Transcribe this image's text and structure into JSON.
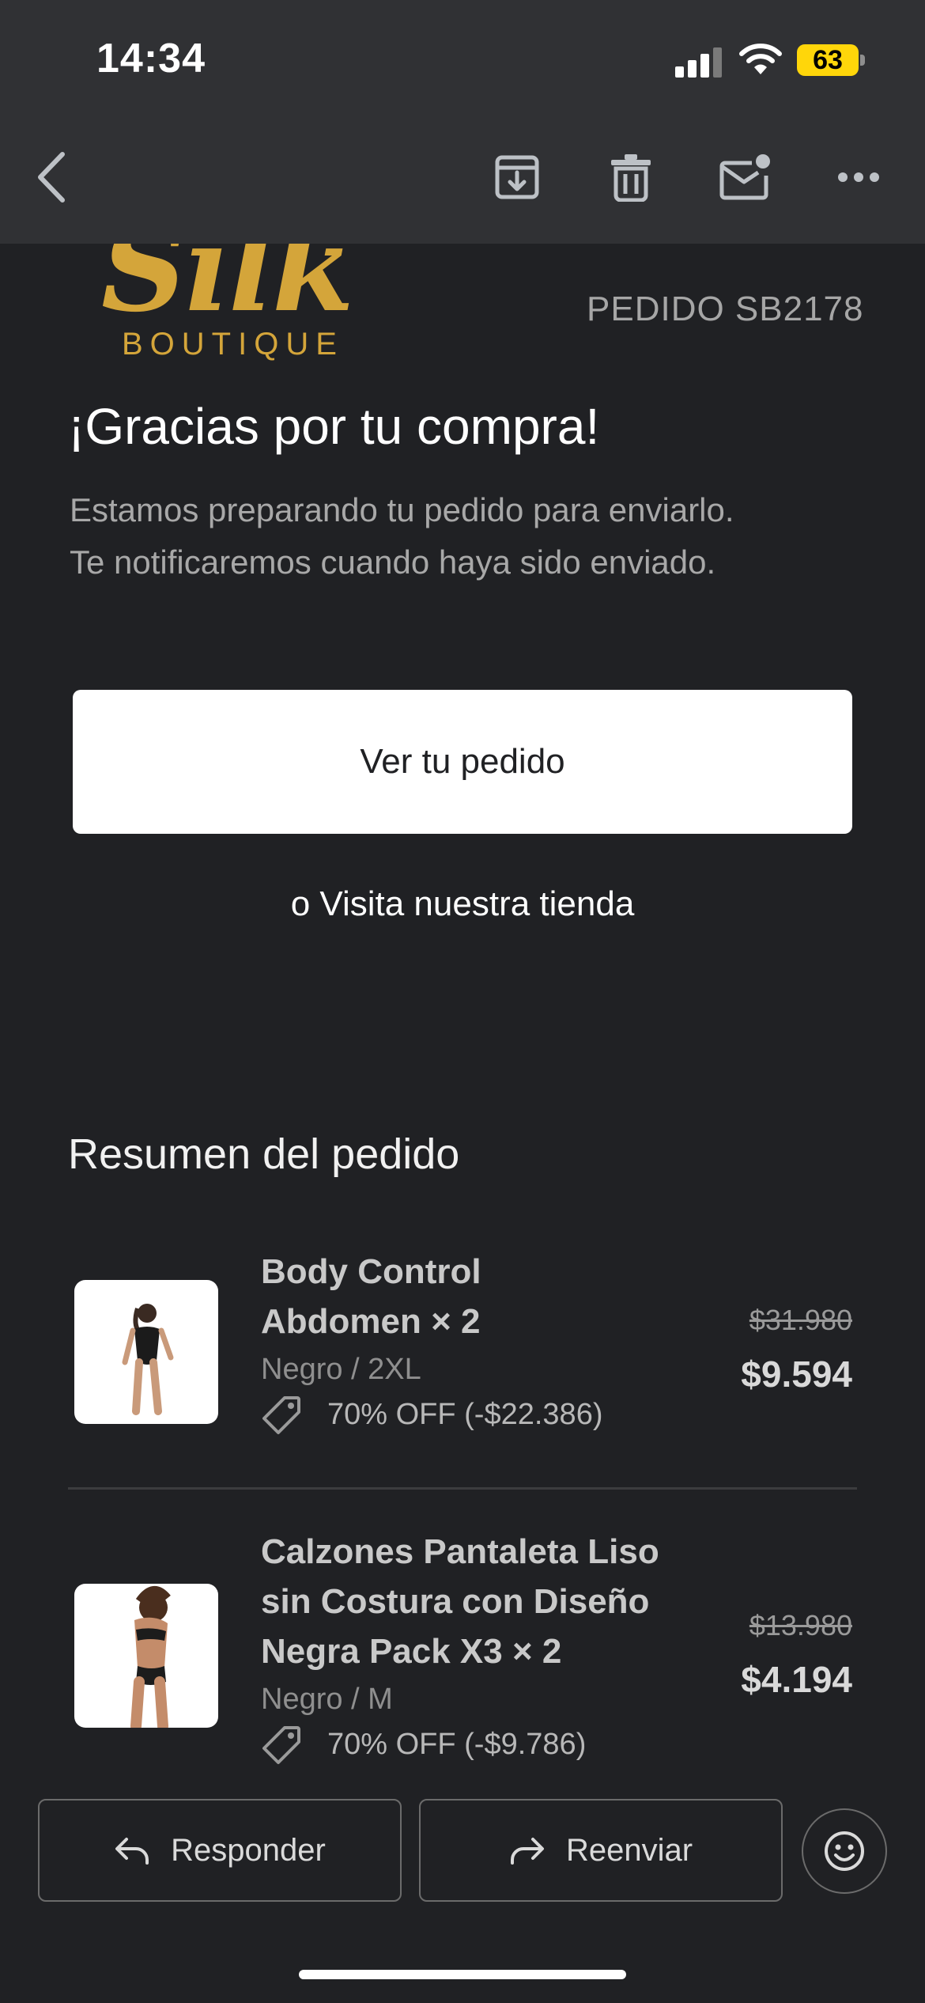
{
  "status_bar": {
    "time": "14:34",
    "battery": "63"
  },
  "toolbar": {
    "back": "back-icon",
    "archive": "archive-icon",
    "delete": "trash-icon",
    "mark_unread": "mark-unread-icon",
    "more": "more-icon"
  },
  "email": {
    "brand_script": "Silk",
    "brand_sub": "BOUTIQUE",
    "order_number": "PEDIDO SB2178",
    "heading": "¡Gracias por tu compra!",
    "body_line1": "Estamos preparando tu pedido para enviarlo.",
    "body_line2": "Te notificaremos cuando haya sido enviado.",
    "cta_label": "Ver tu pedido",
    "visit_prefix": "o",
    "visit_link": "Visita nuestra tienda",
    "summary_title": "Resumen del pedido",
    "items": [
      {
        "name_line1": "Body Control",
        "name_line2": "Abdomen × 2",
        "variant": "Negro / 2XL",
        "discount": "70% OFF (-$22.386)",
        "price_original": "$31.980",
        "price_final": "$9.594"
      },
      {
        "name_line1": "Calzones Pantaleta Liso",
        "name_line2": "sin Costura con Diseño",
        "name_line3": "Negra Pack X3 × 2",
        "variant": "Negro / M",
        "discount": "70% OFF (-$9.786)",
        "price_original": "$13.980",
        "price_final": "$4.194"
      }
    ]
  },
  "actions": {
    "reply": "Responder",
    "forward": "Reenviar"
  },
  "colors": {
    "background": "#202124",
    "toolbar": "#303134",
    "gold": "#d4a53a",
    "battery": "#ffd60a"
  }
}
